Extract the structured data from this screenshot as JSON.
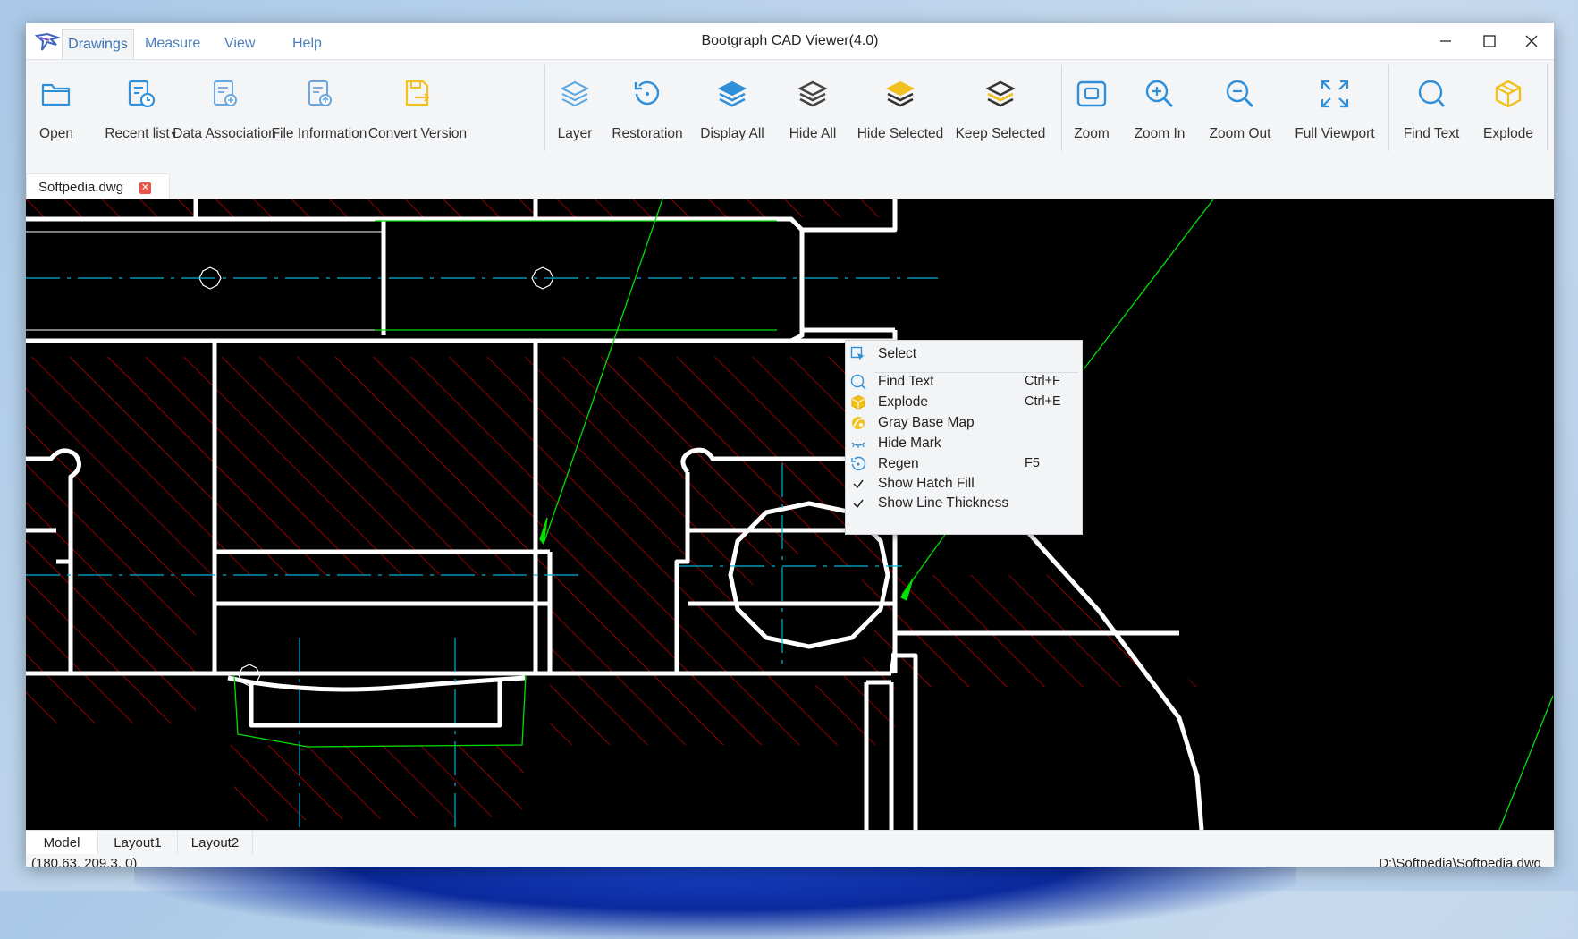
{
  "app": {
    "title": "Bootgraph CAD Viewer(4.0)",
    "menu_tabs": [
      "Drawings",
      "Measure",
      "View",
      "Help"
    ],
    "window_buttons": [
      "minimize-icon",
      "maximize-icon",
      "close-icon"
    ]
  },
  "ribbon": {
    "buttons": [
      {
        "label": "Open",
        "icon": "folder-icon",
        "color": "#2f8fd9"
      },
      {
        "label": "Recent list",
        "icon": "recent-list-icon",
        "color": "#2f8fd9"
      },
      {
        "label": "Data Association",
        "icon": "data-association-icon",
        "color": "#2f8fd9"
      },
      {
        "label": "File Information",
        "icon": "file-information-icon",
        "color": "#2f8fd9"
      },
      {
        "label": "Convert Version",
        "icon": "convert-version-icon",
        "color": "#f2c01f"
      },
      {
        "label": "Layer",
        "icon": "layer-icon",
        "color": "#2f8fd9"
      },
      {
        "label": "Restoration",
        "icon": "restoration-icon",
        "color": "#2f8fd9"
      },
      {
        "label": "Display All",
        "icon": "display-all-icon",
        "color": "#2f8fd9"
      },
      {
        "label": "Hide All",
        "icon": "hide-all-icon",
        "color": "#444444"
      },
      {
        "label": "Hide Selected",
        "icon": "hide-selected-icon",
        "color": "#f2c01f"
      },
      {
        "label": "Keep Selected",
        "icon": "keep-selected-icon",
        "color": "#444444"
      },
      {
        "label": "Zoom",
        "icon": "zoom-window-icon",
        "color": "#2f8fd9"
      },
      {
        "label": "Zoom In",
        "icon": "zoom-in-icon",
        "color": "#2f8fd9"
      },
      {
        "label": "Zoom Out",
        "icon": "zoom-out-icon",
        "color": "#2f8fd9"
      },
      {
        "label": "Full Viewport",
        "icon": "full-viewport-icon",
        "color": "#2f8fd9"
      },
      {
        "label": "Find Text",
        "icon": "find-text-icon",
        "color": "#2f8fd9"
      },
      {
        "label": "Explode",
        "icon": "explode-icon",
        "color": "#f2c01f"
      }
    ]
  },
  "document_tab": {
    "label": "Softpedia.dwg",
    "close_icon": "close-icon"
  },
  "context_menu": {
    "items": [
      {
        "label": "Select",
        "shortcut": "",
        "icon": "select-cursor-icon",
        "checked": false
      },
      {
        "label": "Find Text",
        "shortcut": "Ctrl+F",
        "icon": "find-text-icon",
        "checked": false
      },
      {
        "label": "Explode",
        "shortcut": "Ctrl+E",
        "icon": "explode-icon",
        "checked": false
      },
      {
        "label": "Gray Base Map",
        "shortcut": "",
        "icon": "gray-base-map-icon",
        "checked": false
      },
      {
        "label": "Hide Mark",
        "shortcut": "",
        "icon": "hide-mark-icon",
        "checked": false
      },
      {
        "label": "Regen",
        "shortcut": "F5",
        "icon": "regen-icon",
        "checked": false
      },
      {
        "label": "Show Hatch Fill",
        "shortcut": "",
        "icon": "checkmark-icon",
        "checked": true
      },
      {
        "label": "Show Line Thickness",
        "shortcut": "",
        "icon": "checkmark-icon",
        "checked": true
      }
    ]
  },
  "layout_tabs": [
    "Model",
    "Layout1",
    "Layout2"
  ],
  "status": {
    "coordinates": "(180.63, 209.3, 0)",
    "file_path": "D:\\Softpedia\\Softpedia.dwg"
  },
  "colors": {
    "accent": "#2f8fd9",
    "canvas_background": "#000000",
    "hatch": "#e00000",
    "centerline": "#00b4d8",
    "leader": "#00e000",
    "outline": "#ffffff"
  }
}
